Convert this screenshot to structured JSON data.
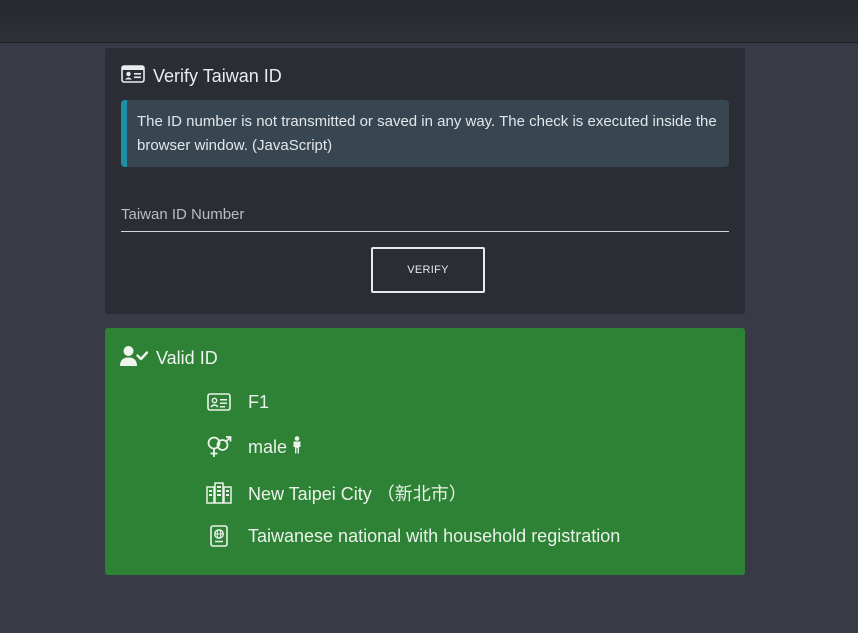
{
  "verify_card": {
    "title": "Verify Taiwan ID",
    "info": "The ID number is not transmitted or saved in any way. The check is executed inside the browser window. (JavaScript)",
    "input_placeholder": "Taiwan ID Number",
    "input_value": "",
    "button_label": "VERIFY"
  },
  "result": {
    "title": "Valid ID",
    "id_number": "F1",
    "gender": "male",
    "region": "New Taipei City （新北市）",
    "status": "Taiwanese national with household registration"
  },
  "colors": {
    "page_bg": "#383b45",
    "card_bg": "#2a2d33",
    "info_bg": "#374650",
    "info_accent": "#1f8fa6",
    "success_bg": "#2e8235"
  },
  "icons": [
    "id-card-icon",
    "user-check-icon",
    "gender-icon",
    "male-figure-icon",
    "buildings-icon",
    "passport-icon"
  ]
}
